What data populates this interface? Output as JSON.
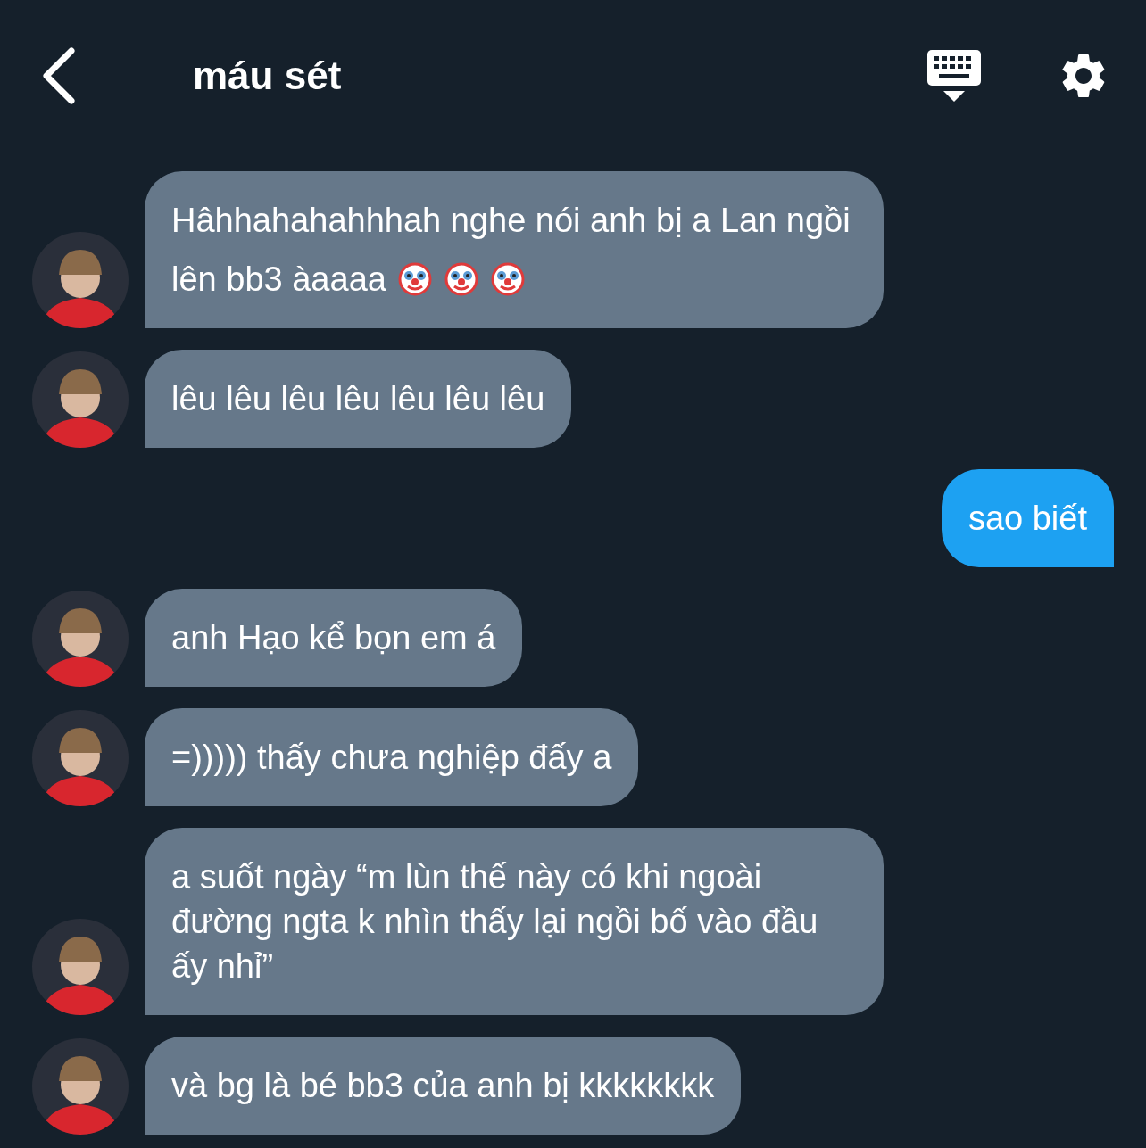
{
  "header": {
    "title": "máu sét"
  },
  "messages": [
    {
      "kind": "incoming",
      "text": "Hâhhahahahhhah nghe nói anh bị a Lan ngồi lên bb3 àaaaa",
      "emojis": [
        {
          "kind": "clown"
        },
        {
          "kind": "clown"
        },
        {
          "kind": "clown"
        }
      ]
    },
    {
      "kind": "incoming",
      "text": "lêu lêu lêu lêu lêu lêu lêu"
    },
    {
      "kind": "outgoing",
      "text": "sao biết"
    },
    {
      "kind": "incoming",
      "text": "anh Hạo kể bọn em á"
    },
    {
      "kind": "incoming",
      "text": "=))))) thấy chưa nghiệp đấy a"
    },
    {
      "kind": "incoming",
      "text": "a suốt ngày “m lùn thế này có khi ngoài đường ngta k nhìn thấy lại ngồi bố vào đầu ấy nhỉ”"
    },
    {
      "kind": "incoming",
      "text": "và bg là bé bb3 của anh bị kkkkkkkk"
    }
  ]
}
